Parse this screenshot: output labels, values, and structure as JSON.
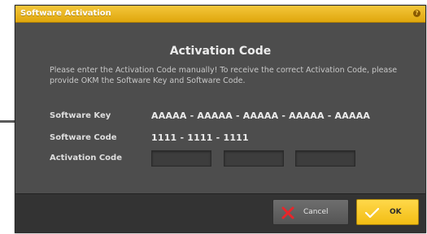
{
  "window": {
    "title": "Software Activation",
    "help_icon": "help-icon",
    "accent_color": "#f2bd14"
  },
  "content": {
    "heading": "Activation Code",
    "instruction": "Please enter the Activation Code manually! To receive the correct Activation Code, please provide OKM the Software Key and Software Code."
  },
  "fields": {
    "software_key_label": "Software Key",
    "software_key_value": "AAAAA - AAAAA - AAAAA - AAAAA - AAAAA",
    "software_code_label": "Software Code",
    "software_code_value": "1111 - 1111 - 1111",
    "activation_code_label": "Activation Code",
    "activation_code_parts": [
      "",
      "",
      ""
    ]
  },
  "footer": {
    "cancel_label": "Cancel",
    "cancel_icon": "close-icon",
    "ok_label": "OK",
    "ok_icon": "checkmark-icon"
  }
}
